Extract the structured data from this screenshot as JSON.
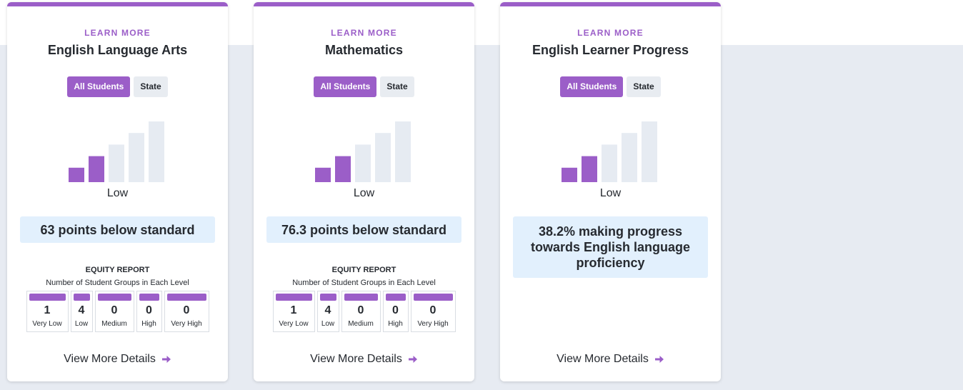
{
  "cards": [
    {
      "learn_more": "LEARN MORE",
      "title": "English Language Arts",
      "toggle_all": "All Students",
      "toggle_state": "State",
      "level": "Low",
      "level_index": 2,
      "level_total": 5,
      "status": "63 points below standard",
      "has_equity": true,
      "equity_title": "EQUITY REPORT",
      "equity_subtitle": "Number of Student Groups in Each Level",
      "equity": [
        {
          "count": "1",
          "label": "Very Low"
        },
        {
          "count": "4",
          "label": "Low"
        },
        {
          "count": "0",
          "label": "Medium"
        },
        {
          "count": "0",
          "label": "High"
        },
        {
          "count": "0",
          "label": "Very High"
        }
      ],
      "view_more": "View More Details"
    },
    {
      "learn_more": "LEARN MORE",
      "title": "Mathematics",
      "toggle_all": "All Students",
      "toggle_state": "State",
      "level": "Low",
      "level_index": 2,
      "level_total": 5,
      "status": "76.3 points below standard",
      "has_equity": true,
      "equity_title": "EQUITY REPORT",
      "equity_subtitle": "Number of Student Groups in Each Level",
      "equity": [
        {
          "count": "1",
          "label": "Very Low"
        },
        {
          "count": "4",
          "label": "Low"
        },
        {
          "count": "0",
          "label": "Medium"
        },
        {
          "count": "0",
          "label": "High"
        },
        {
          "count": "0",
          "label": "Very High"
        }
      ],
      "view_more": "View More Details"
    },
    {
      "learn_more": "LEARN MORE",
      "title": "English Learner Progress",
      "toggle_all": "All Students",
      "toggle_state": "State",
      "level": "Low",
      "level_index": 2,
      "level_total": 5,
      "status": "38.2% making progress towards English language proficiency",
      "has_equity": false,
      "view_more": "View More Details"
    }
  ],
  "colors": {
    "accent": "#9b5ec8",
    "bar_inactive": "#e6ebf2",
    "status_bg": "#e2f0fd",
    "background_band": "#e7ebf2"
  },
  "icons": {
    "view_more": "arrow-right-icon",
    "level_chart": "level-bars-icon"
  }
}
